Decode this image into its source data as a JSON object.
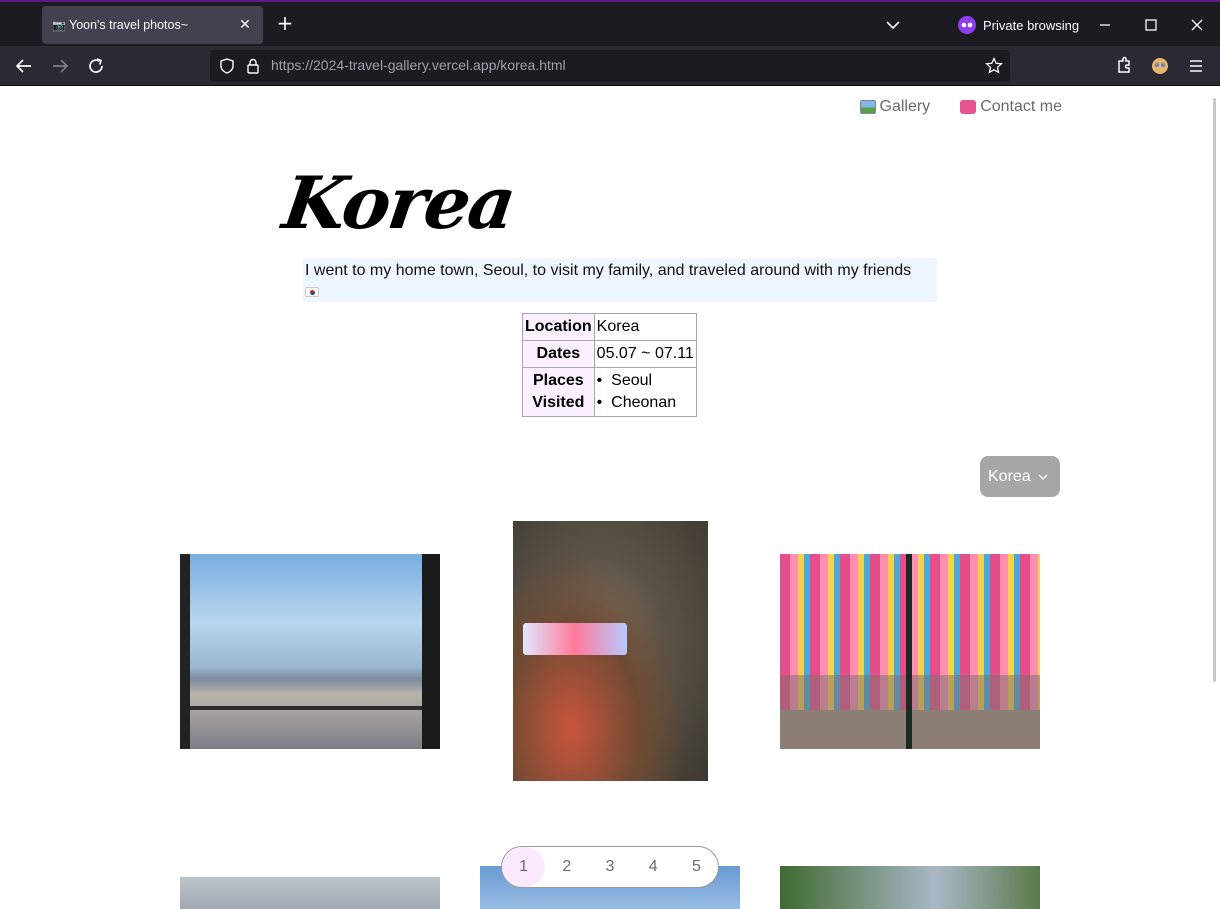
{
  "browser": {
    "tab_title": "Yoon's travel photos~",
    "tab_favicon": "📷",
    "private_label": "Private browsing",
    "url_host": "https://2024-travel-gallery.vercel.app",
    "url_path": "/korea.html"
  },
  "nav": {
    "gallery_label": "Gallery",
    "contact_label": "Contact me"
  },
  "page": {
    "title": "Korea",
    "intro": "I went to my home town, Seoul, to visit my family, and traveled around with my friends",
    "intro_flag": "🇰🇷"
  },
  "info_table": {
    "location_label": "Location",
    "location_value": "Korea",
    "dates_label": "Dates",
    "dates_value": "05.07 ~ 07.11",
    "places_label_1": "Places",
    "places_label_2": "Visited",
    "places": [
      "Seoul",
      "Cheonan"
    ]
  },
  "filter": {
    "selected": "Korea"
  },
  "pagination": {
    "pages": [
      "1",
      "2",
      "3",
      "4",
      "5"
    ],
    "active": "1"
  },
  "colors": {
    "intro_bg": "#eef6ff",
    "table_header_bg": "#fbf0ff",
    "dropdown_bg": "#a7a7a7",
    "pager_active_bg": "#fbeaff",
    "private_accent": "#8f3df0"
  }
}
